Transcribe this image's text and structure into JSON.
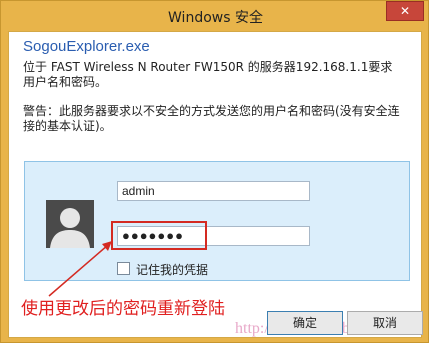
{
  "window": {
    "title": "Windows 安全",
    "close_label": "✕"
  },
  "dialog": {
    "app_name": "SogouExplorer.exe",
    "message": "位于 FAST Wireless N Router FW150R 的服务器192.168.1.1要求用户名和密码。",
    "warning": "警告：此服务器要求以不安全的方式发送您的用户名和密码(没有安全连接的基本认证)。"
  },
  "credentials": {
    "username_value": "admin",
    "password_value": "●●●●●●●",
    "remember_label": "记住我的凭据",
    "avatar_icon": "user-silhouette-icon"
  },
  "annotation": {
    "text": "使用更改后的密码重新登陆",
    "color": "#e02020"
  },
  "buttons": {
    "ok_label": "确定",
    "cancel_label": "取消"
  },
  "watermark": {
    "text": "http://www.886abc.com"
  },
  "colors": {
    "frame": "#e8b44a",
    "panel": "#dbeefb",
    "accent_red": "#d42a22",
    "app_name": "#2a5db0"
  }
}
